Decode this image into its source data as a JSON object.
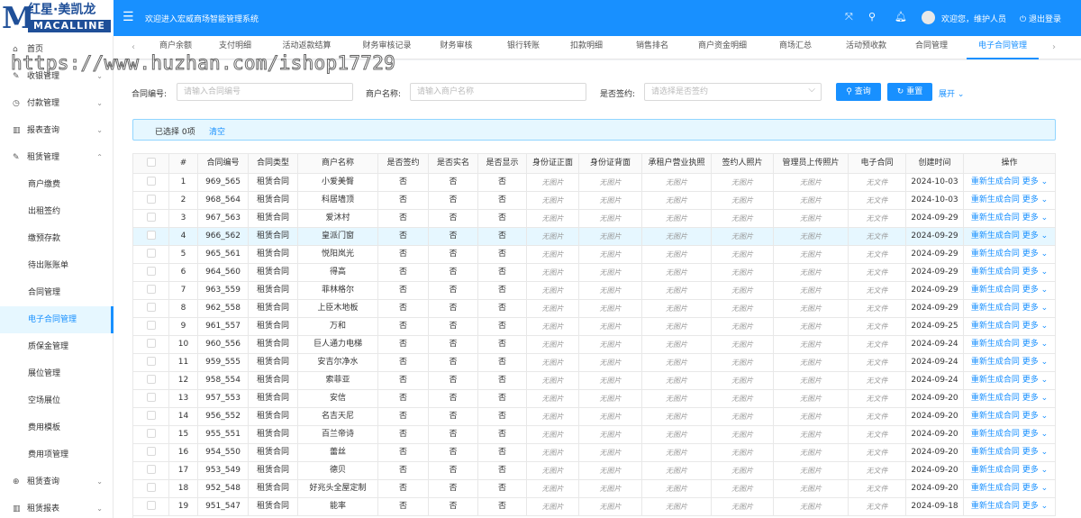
{
  "header": {
    "logo_cn": "红星·美凯龙",
    "logo_en": "MACALLINE",
    "welcome": "欢迎进入宏威商场智能管理系统",
    "user_greeting": "欢迎您，维护人员",
    "logout": "退出登录"
  },
  "sidebar": {
    "items": [
      {
        "label": "首页",
        "icon": "home-icon",
        "glyph": "⌂"
      },
      {
        "label": "收银管理",
        "icon": "edit-icon",
        "glyph": "✎",
        "caret": "⌄"
      },
      {
        "label": "付款管理",
        "icon": "clock-icon",
        "glyph": "◷",
        "caret": "⌄"
      },
      {
        "label": "报表查询",
        "icon": "bar-chart-icon",
        "glyph": "▥",
        "caret": "⌄"
      },
      {
        "label": "租赁管理",
        "icon": "edit-icon",
        "glyph": "✎",
        "caret": "⌃",
        "open": true
      },
      {
        "label": "商户缴费",
        "sub": true
      },
      {
        "label": "出租签约",
        "sub": true
      },
      {
        "label": "缴预存款",
        "sub": true
      },
      {
        "label": "待出账账单",
        "sub": true
      },
      {
        "label": "合同管理",
        "sub": true
      },
      {
        "label": "电子合同管理",
        "sub": true,
        "active": true
      },
      {
        "label": "质保金管理",
        "sub": true
      },
      {
        "label": "展位管理",
        "sub": true
      },
      {
        "label": "空场展位",
        "sub": true
      },
      {
        "label": "费用模板",
        "sub": true
      },
      {
        "label": "费用项管理",
        "sub": true
      },
      {
        "label": "租赁查询",
        "icon": "search-plus-icon",
        "glyph": "⊕",
        "caret": "⌄"
      },
      {
        "label": "租赁报表",
        "icon": "bar-chart-icon",
        "glyph": "▥",
        "caret": "⌄"
      }
    ]
  },
  "tabs": [
    "商户余额",
    "支付明细",
    "活动返款结算",
    "财务审核记录",
    "财务审核",
    "银行转账",
    "扣款明细",
    "销售排名",
    "商户资金明细",
    "商场汇总",
    "活动预收款",
    "合同管理",
    "电子合同管理"
  ],
  "active_tab": "电子合同管理",
  "watermark": "https://www.huzhan.com/ishop17729",
  "filters": {
    "contract_no_label": "合同编号:",
    "contract_no_placeholder": "请输入合同编号",
    "merchant_label": "商户名称:",
    "merchant_placeholder": "请输入商户名称",
    "signed_label": "是否签约:",
    "signed_placeholder": "请选择是否签约",
    "query_button": "查询",
    "reset_button": "重置",
    "expand": "展开"
  },
  "selection": {
    "text": "已选择 0项",
    "clear": "清空"
  },
  "table": {
    "columns": [
      "",
      "#",
      "合同编号",
      "合同类型",
      "商户名称",
      "是否签约",
      "是否实名",
      "是否显示",
      "身份证正面",
      "身份证背面",
      "承租户营业执照",
      "签约人照片",
      "管理员上传照片",
      "电子合同",
      "创建时间",
      "操作"
    ],
    "no_image": "无图片",
    "no_file": "无文件",
    "action_regen": "重新生成合同",
    "action_more": "更多",
    "rows": [
      {
        "n": "1",
        "no": "969_565",
        "type": "租赁合同",
        "name": "小爱美臀",
        "signed": "否",
        "real": "否",
        "show": "否",
        "date": "2024-10-03"
      },
      {
        "n": "2",
        "no": "968_564",
        "type": "租赁合同",
        "name": "科居墙顶",
        "signed": "否",
        "real": "否",
        "show": "否",
        "date": "2024-10-03"
      },
      {
        "n": "3",
        "no": "967_563",
        "type": "租赁合同",
        "name": "爱沐村",
        "signed": "否",
        "real": "否",
        "show": "否",
        "date": "2024-09-29"
      },
      {
        "n": "4",
        "no": "966_562",
        "type": "租赁合同",
        "name": "皇派门窗",
        "signed": "否",
        "real": "否",
        "show": "否",
        "date": "2024-09-29"
      },
      {
        "n": "5",
        "no": "965_561",
        "type": "租赁合同",
        "name": "悦阳岚光",
        "signed": "否",
        "real": "否",
        "show": "否",
        "date": "2024-09-29"
      },
      {
        "n": "6",
        "no": "964_560",
        "type": "租赁合同",
        "name": "得高",
        "signed": "否",
        "real": "否",
        "show": "否",
        "date": "2024-09-29"
      },
      {
        "n": "7",
        "no": "963_559",
        "type": "租赁合同",
        "name": "菲林格尔",
        "signed": "否",
        "real": "否",
        "show": "否",
        "date": "2024-09-29"
      },
      {
        "n": "8",
        "no": "962_558",
        "type": "租赁合同",
        "name": "上臣木地板",
        "signed": "否",
        "real": "否",
        "show": "否",
        "date": "2024-09-29"
      },
      {
        "n": "9",
        "no": "961_557",
        "type": "租赁合同",
        "name": "万和",
        "signed": "否",
        "real": "否",
        "show": "否",
        "date": "2024-09-25"
      },
      {
        "n": "10",
        "no": "960_556",
        "type": "租赁合同",
        "name": "巨人通力电梯",
        "signed": "否",
        "real": "否",
        "show": "否",
        "date": "2024-09-24"
      },
      {
        "n": "11",
        "no": "959_555",
        "type": "租赁合同",
        "name": "安吉尔净水",
        "signed": "否",
        "real": "否",
        "show": "否",
        "date": "2024-09-24"
      },
      {
        "n": "12",
        "no": "958_554",
        "type": "租赁合同",
        "name": "索菲亚",
        "signed": "否",
        "real": "否",
        "show": "否",
        "date": "2024-09-24"
      },
      {
        "n": "13",
        "no": "957_553",
        "type": "租赁合同",
        "name": "安信",
        "signed": "否",
        "real": "否",
        "show": "否",
        "date": "2024-09-20"
      },
      {
        "n": "14",
        "no": "956_552",
        "type": "租赁合同",
        "name": "名吉天尼",
        "signed": "否",
        "real": "否",
        "show": "否",
        "date": "2024-09-20"
      },
      {
        "n": "15",
        "no": "955_551",
        "type": "租赁合同",
        "name": "百兰帝诗",
        "signed": "否",
        "real": "否",
        "show": "否",
        "date": "2024-09-20"
      },
      {
        "n": "16",
        "no": "954_550",
        "type": "租赁合同",
        "name": "蕾丝",
        "signed": "否",
        "real": "否",
        "show": "否",
        "date": "2024-09-20"
      },
      {
        "n": "17",
        "no": "953_549",
        "type": "租赁合同",
        "name": "德贝",
        "signed": "否",
        "real": "否",
        "show": "否",
        "date": "2024-09-20"
      },
      {
        "n": "18",
        "no": "952_548",
        "type": "租赁合同",
        "name": "好兆头全屋定制",
        "signed": "否",
        "real": "否",
        "show": "否",
        "date": "2024-09-20"
      },
      {
        "n": "19",
        "no": "951_547",
        "type": "租赁合同",
        "name": "能率",
        "signed": "否",
        "real": "否",
        "show": "否",
        "date": "2024-09-18"
      }
    ]
  },
  "colors": {
    "primary": "#1890ff",
    "highlight_row": "#e6f7ff"
  }
}
